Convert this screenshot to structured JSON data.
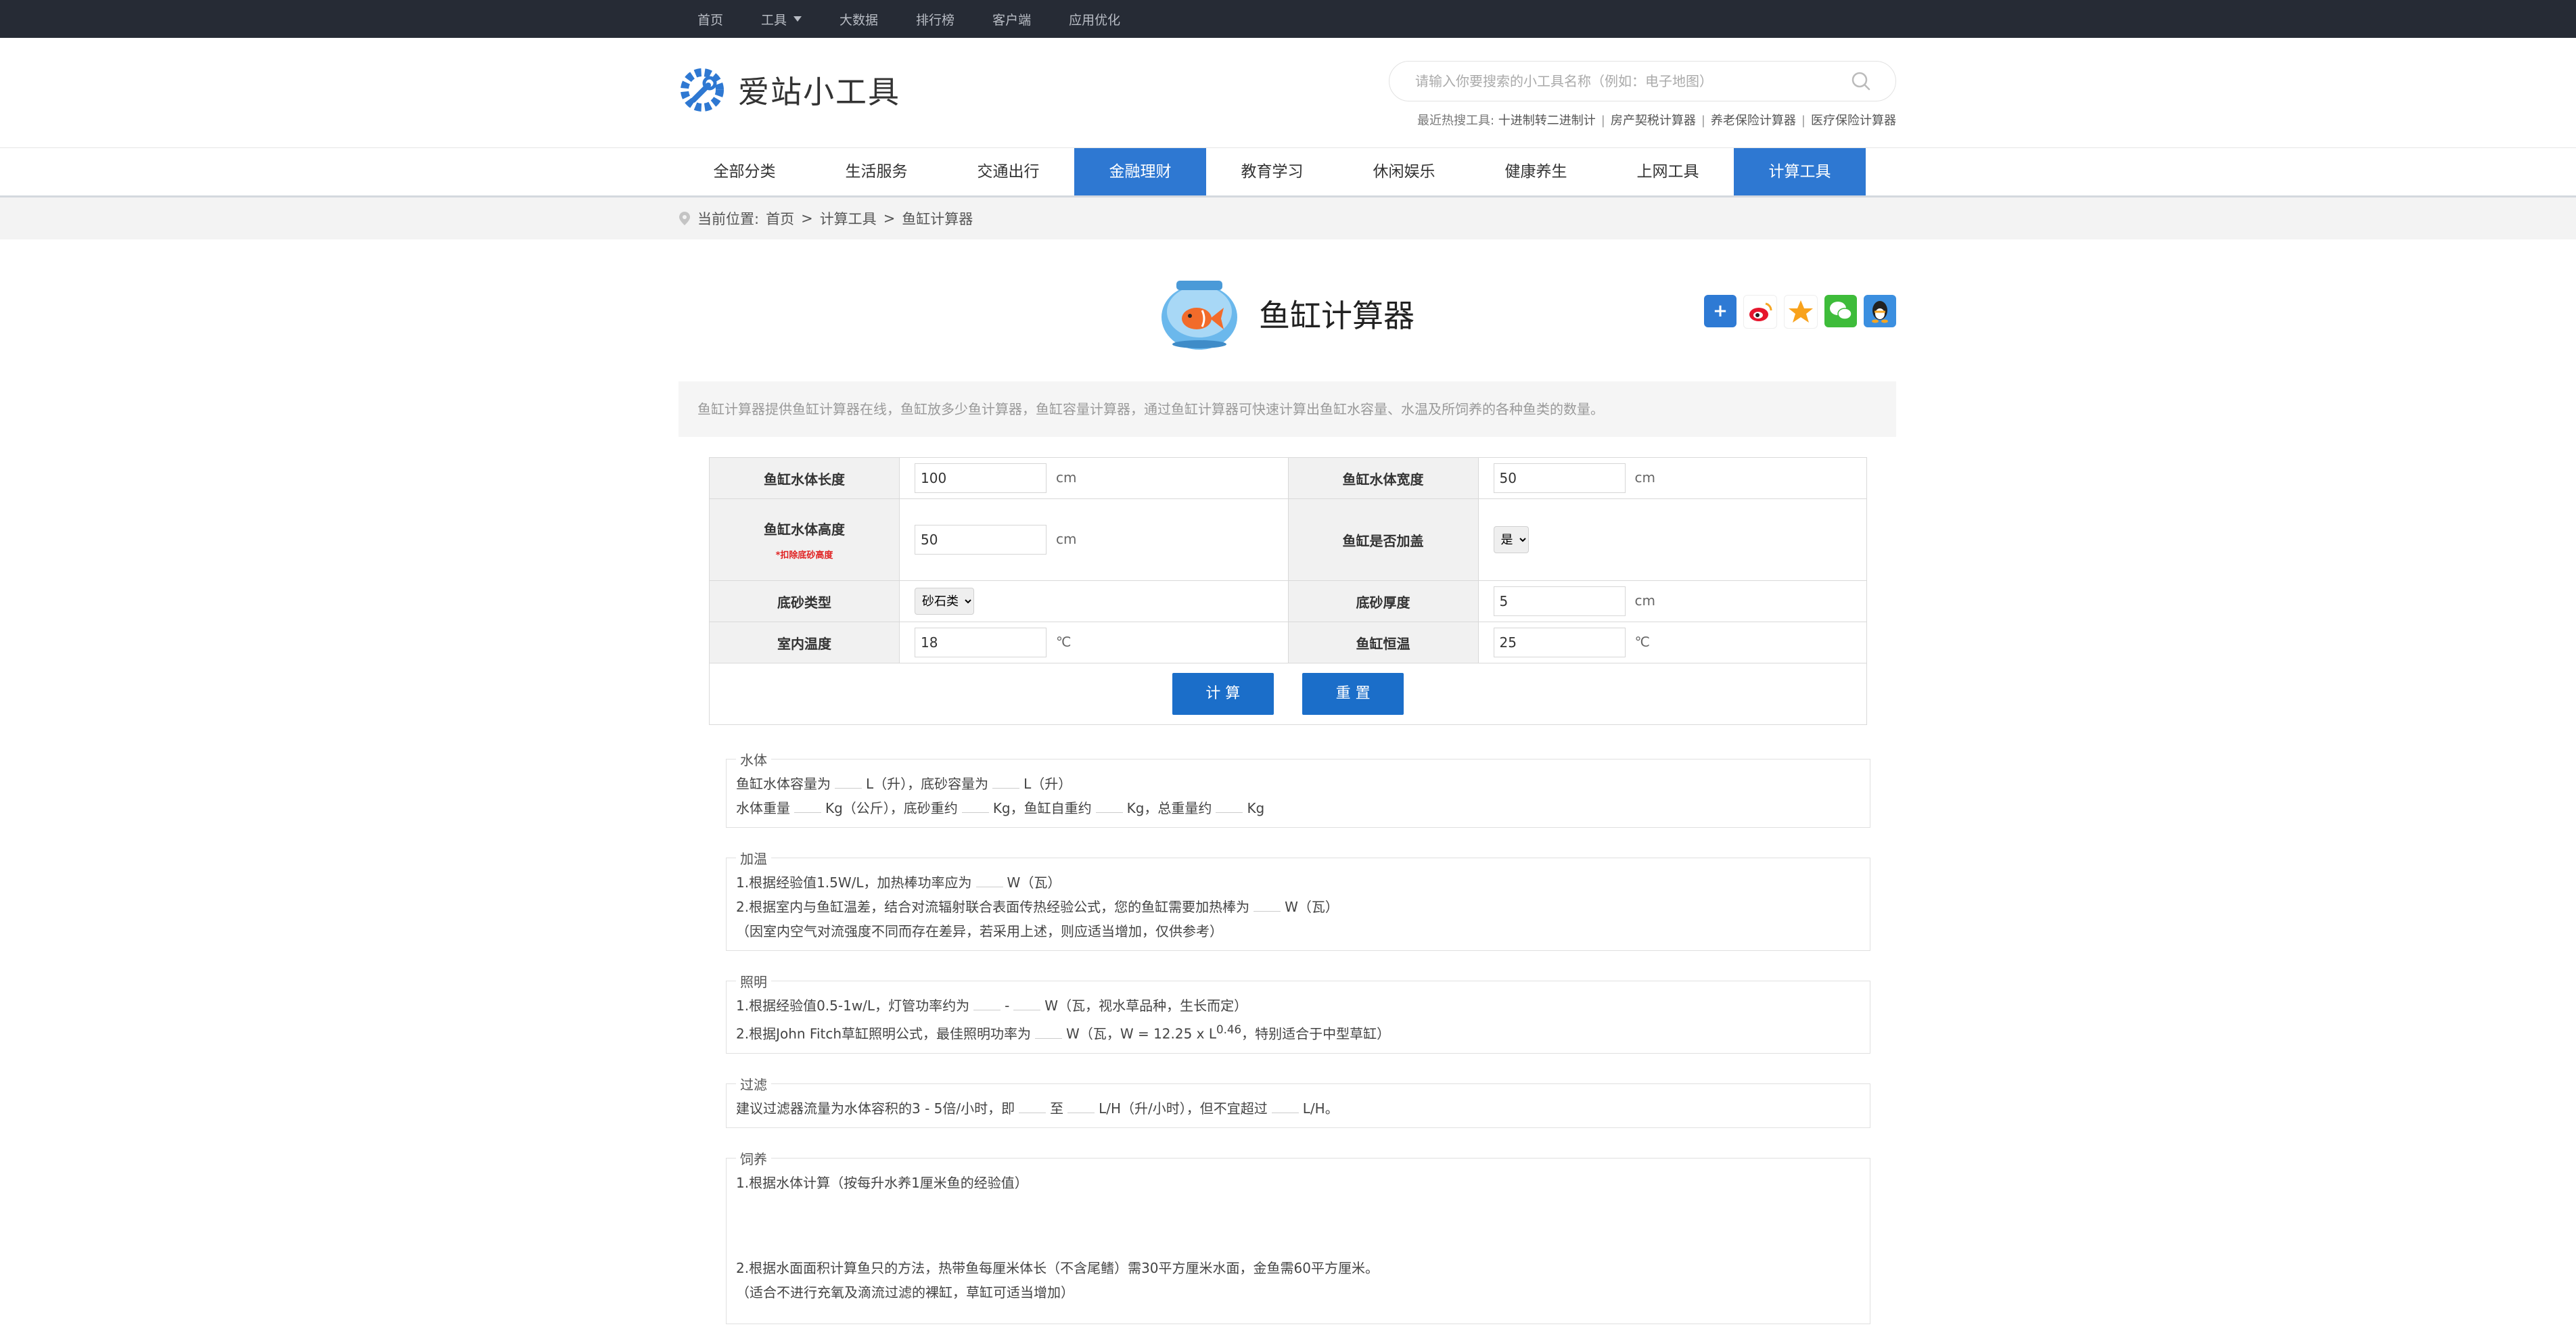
{
  "topnav": {
    "items": [
      "首页",
      "工具",
      "大数据",
      "排行榜",
      "客户端",
      "应用优化"
    ]
  },
  "header": {
    "logo_text": "爱站小工具",
    "search_placeholder": "请输入你要搜索的小工具名称（例如：电子地图）",
    "hot_label": "最近热搜工具:",
    "hot_items": [
      "十进制转二进制计",
      "房产契税计算器",
      "养老保险计算器",
      "医疗保险计算器"
    ]
  },
  "mainnav": {
    "items": [
      "全部分类",
      "生活服务",
      "交通出行",
      "金融理财",
      "教育学习",
      "休闲娱乐",
      "健康养生",
      "上网工具",
      "计算工具"
    ]
  },
  "breadcrumb": {
    "label": "当前位置:",
    "home": "首页",
    "sep": ">",
    "category": "计算工具",
    "current": "鱼缸计算器"
  },
  "page": {
    "title": "鱼缸计算器",
    "description": "鱼缸计算器提供鱼缸计算器在线，鱼缸放多少鱼计算器，鱼缸容量计算器，通过鱼缸计算器可快速计算出鱼缸水容量、水温及所饲养的各种鱼类的数量。"
  },
  "form": {
    "length_label": "鱼缸水体长度",
    "length_value": "100",
    "cm": "cm",
    "width_label": "鱼缸水体宽度",
    "width_value": "50",
    "height_label": "鱼缸水体高度",
    "height_note": "*扣除底砂高度",
    "height_value": "50",
    "cover_label": "鱼缸是否加盖",
    "cover_value": "是",
    "substrate_label": "底砂类型",
    "substrate_value": "砂石类",
    "substrate_thickness_label": "底砂厚度",
    "substrate_thickness_value": "5",
    "room_temp_label": "室内温度",
    "room_temp_value": "18",
    "celsius": "℃",
    "tank_temp_label": "鱼缸恒温",
    "tank_temp_value": "25",
    "calc_button": "计 算",
    "reset_button": "重 置"
  },
  "results": {
    "water": {
      "legend": "水体",
      "l1a": "鱼缸水体容量为",
      "l1b": "L（升），底砂容量为",
      "l1c": "L（升）",
      "l2a": "水体重量",
      "l2b": "Kg（公斤），底砂重约",
      "l2c": "Kg，鱼缸自重约",
      "l2d": "Kg，总重量约",
      "l2e": "Kg"
    },
    "heat": {
      "legend": "加温",
      "l1a": "1.根据经验值1.5W/L，加热棒功率应为",
      "l1b": "W（瓦）",
      "l2a": "2.根据室内与鱼缸温差，结合对流辐射联合表面传热经验公式，您的鱼缸需要加热棒为",
      "l2b": "W（瓦）",
      "l3": "（因室内空气对流强度不同而存在差异，若采用上述，则应适当增加，仅供参考）"
    },
    "light": {
      "legend": "照明",
      "l1a": "1.根据经验值0.5-1w/L，灯管功率约为",
      "l1dash": "-",
      "l1b": "W（瓦，视水草品种，生长而定）",
      "l2a": "2.根据John Fitch草缸照明公式，最佳照明功率为",
      "l2b": "W（瓦，W = 12.25 x L",
      "l2sup": "0.46",
      "l2c": "，特别适合于中型草缸）"
    },
    "filter": {
      "legend": "过滤",
      "l1a": "建议过滤器流量为水体容积的3 - 5倍/小时，即",
      "l1b": "至",
      "l1c": "L/H（升/小时），但不宜超过",
      "l1d": "L/H。"
    },
    "feed": {
      "legend": "饲养",
      "l1": "1.根据水体计算（按每升水养1厘米鱼的经验值）",
      "l2": "2.根据水面面积计算鱼只的方法，热带鱼每厘米体长（不含尾鳍）需30平方厘米水面，金鱼需60平方厘米。",
      "l3": "（适合不进行充氧及滴流过滤的裸缸，草缸可适当增加）"
    }
  },
  "colors": {
    "accent": "#2e78d2",
    "button": "#1b6ec9",
    "topbar": "#262b35"
  }
}
